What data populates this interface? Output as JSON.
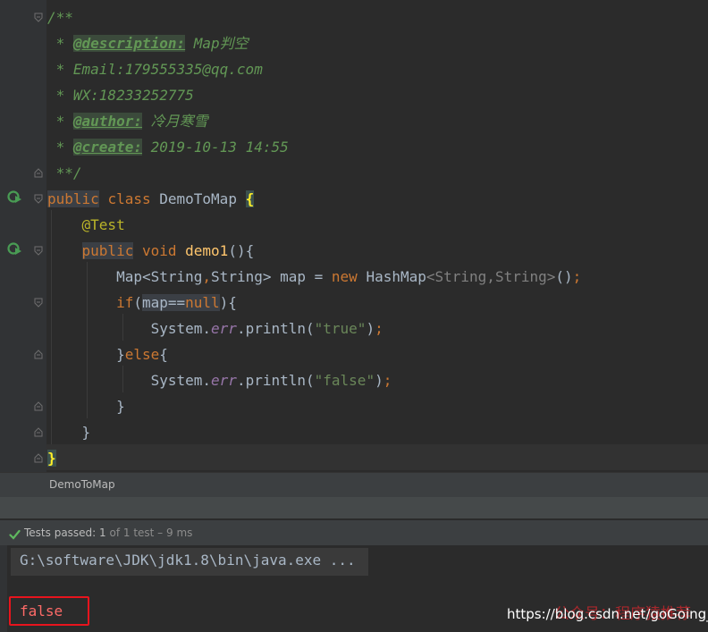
{
  "editor": {
    "doc_lines": [
      "/**",
      " * ",
      "@description:",
      " Map判空",
      " * Email:179555335@qq.com",
      " * WX:18233252775",
      " * ",
      "@author:",
      " 冷月寒雪",
      " * ",
      "@create:",
      " 2019-10-13 14:55",
      " **/"
    ],
    "code": {
      "public": "public",
      "class": "class",
      "class_name": "DemoToMap",
      "open_brace": "{",
      "annotation": "@Test",
      "void": "void",
      "method": "demo1",
      "method_sig": "(){",
      "map_type": "Map",
      "lt": "<",
      "string1": "String",
      "comma": ",",
      "string2": "String",
      "gt_assign": "> map = ",
      "new": "new",
      "hashmap": " HashMap",
      "generic_args": "<String,String>",
      "ctor_end": "()",
      "semicolon": ";",
      "if": "if",
      "paren_open": "(",
      "map_var": "map",
      "eq": "==",
      "null": "null",
      "if_end": "){",
      "system": "System.",
      "err": "err",
      "println": ".println(",
      "str_true": "\"true\"",
      "close_call": ")",
      "else_line_start": "}",
      "else": "else",
      "else_brace": "{",
      "str_false": "\"false\"",
      "close_if": "}",
      "close_method": "}",
      "close_class": "}"
    }
  },
  "breadcrumb": {
    "label": "DemoToMap"
  },
  "status": {
    "passed_label": "Tests passed:",
    "passed_count": " 1",
    "detail": " of 1 test – 9 ms"
  },
  "console": {
    "command": "G:\\software\\JDK\\jdk1.8\\bin\\java.exe ...",
    "output": "false"
  },
  "watermark": {
    "url": "https://blog.csdn.net/goGoing_",
    "overlay": "公众号：程序猿推荐"
  },
  "colors": {
    "background": "#2B2B2B",
    "keyword": "#CC7832",
    "doc": "#629755",
    "error_output": "#FF6B68",
    "highlight_box": "#E8141D"
  }
}
